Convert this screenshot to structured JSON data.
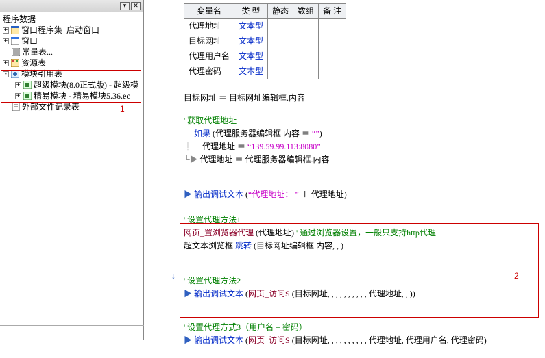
{
  "tree": {
    "header": {
      "collapse": "▾",
      "close": "✕"
    },
    "root": "程序数据",
    "items": [
      {
        "icon": "window-set",
        "label": "窗口程序集_启动窗口"
      },
      {
        "icon": "window",
        "label": "窗口"
      },
      {
        "icon": "const",
        "label": "常量表..."
      },
      {
        "icon": "resource",
        "label": "资源表"
      },
      {
        "icon": "module-ref",
        "label": "模块引用表"
      },
      {
        "icon": "module",
        "label": "超级模块(8.0正式版) - 超级模"
      },
      {
        "icon": "module",
        "label": "精易模块 - 精易模块5.36.ec"
      },
      {
        "icon": "ext-file",
        "label": "外部文件记录表"
      }
    ]
  },
  "annotations": {
    "a1": "1",
    "a2": "2"
  },
  "vartable": {
    "headers": [
      "变量名",
      "类 型",
      "静态",
      "数组",
      "备 注"
    ],
    "rows": [
      {
        "name": "代理地址",
        "type": "文本型"
      },
      {
        "name": "目标网址",
        "type": "文本型"
      },
      {
        "name": "代理用户名",
        "type": "文本型"
      },
      {
        "name": "代理密码",
        "type": "文本型"
      }
    ]
  },
  "code": {
    "l1": {
      "a": "目标网址 ＝ 目标网址编辑框.内容"
    },
    "c_get": "' 获取代理地址",
    "l2": {
      "kw": "如果",
      "expr": " (代理服务器编辑框.内容 ＝ ",
      "str": "“”",
      "close": ")"
    },
    "l3": {
      "a": "代理地址 ＝ ",
      "str": "“139.59.99.113:8080”"
    },
    "l4": {
      "a": "代理地址 ＝ 代理服务器编辑框.内容"
    },
    "l5": {
      "kw": "输出调试文本",
      "open": " (",
      "str": "“代理地址：  ”",
      "rest": " ＋ 代理地址)"
    },
    "c_m1": "' 设置代理方法1",
    "l6": {
      "fn": "网页_置浏览器代理",
      "args": " (代理地址) ",
      "c2": "' 通过浏览器设置，一般只支持http代理"
    },
    "l7": {
      "a": "超文本浏览框.",
      "m": "跳转",
      "args": " (目标网址编辑框.内容, , )"
    },
    "c_m2": "' 设置代理方法2",
    "l8": {
      "kw": "输出调试文本",
      "open": " (",
      "fn": "网页_访问S",
      "args": " (目标网址, , , , , , , , , , 代理地址, , ))"
    },
    "c_m3": "' 设置代理方式3（用户名 +  密码）",
    "l9": {
      "kw": "输出调试文本",
      "open": " (",
      "fn": "网页_访问S",
      "args": " (目标网址, , , , , , , , , , 代理地址, 代理用户名, 代理密码)"
    }
  },
  "arrows": {
    "right": "▶",
    "down": "↓"
  },
  "chart_data": {
    "type": "table",
    "title": "局部变量表",
    "columns": [
      "变量名",
      "类 型",
      "静态",
      "数组",
      "备 注"
    ],
    "rows": [
      [
        "代理地址",
        "文本型",
        "",
        "",
        ""
      ],
      [
        "目标网址",
        "文本型",
        "",
        "",
        ""
      ],
      [
        "代理用户名",
        "文本型",
        "",
        "",
        ""
      ],
      [
        "代理密码",
        "文本型",
        "",
        "",
        ""
      ]
    ]
  }
}
